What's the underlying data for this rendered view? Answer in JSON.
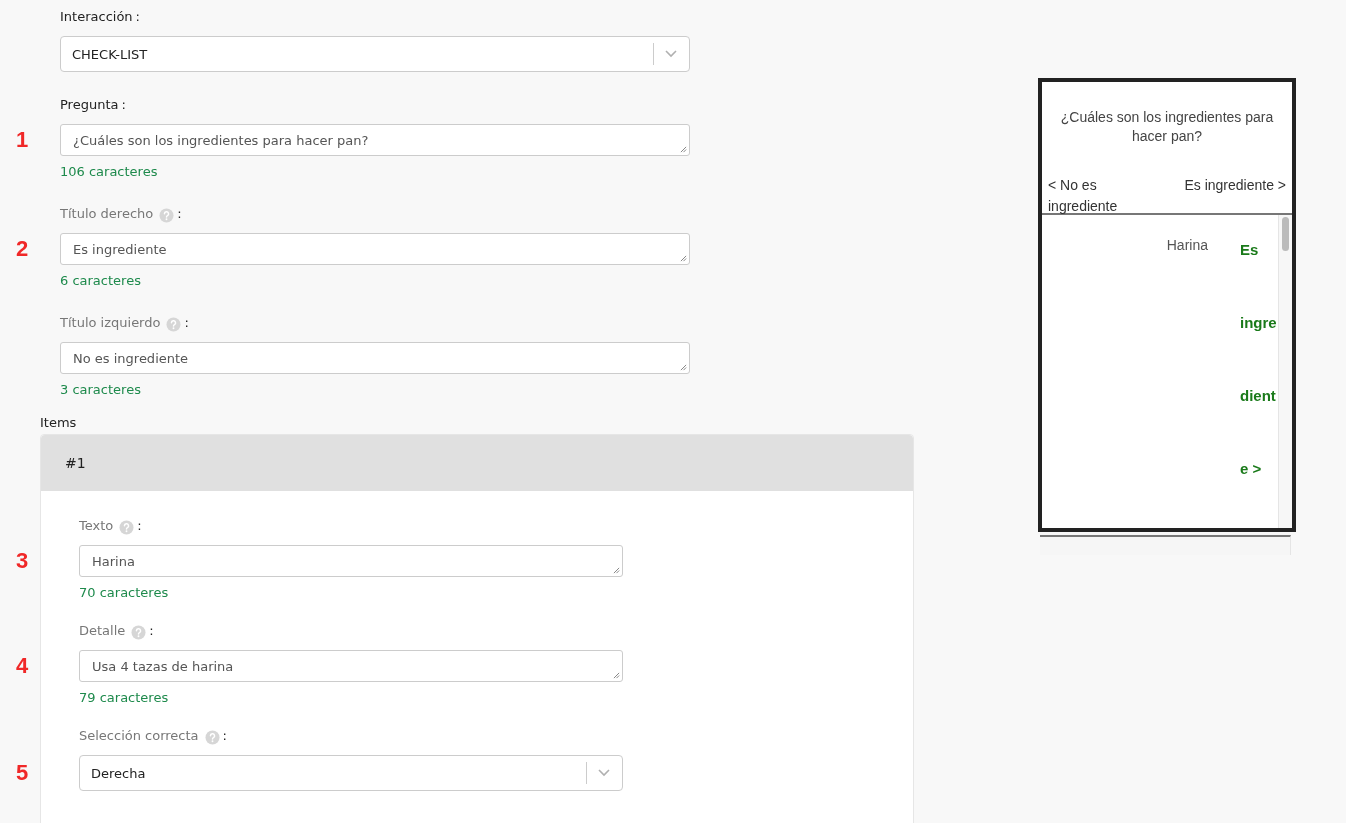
{
  "form_fields": [
    {
      "kind": "select",
      "label": "Interacción",
      "suffix": ":",
      "help": false,
      "value": "CHECK-LIST"
    },
    {
      "kind": "textarea",
      "marker": "1",
      "label": "Pregunta",
      "suffix": ":",
      "help": false,
      "value": "¿Cuáles son los ingredientes para hacer pan?",
      "count": "106 caracteres"
    },
    {
      "kind": "textarea",
      "marker": "2",
      "label": "Título derecho",
      "suffix": ":",
      "help": true,
      "value": "Es ingrediente",
      "count": "6 caracteres"
    },
    {
      "kind": "textarea",
      "label": "Título izquierdo",
      "suffix": ":",
      "help": true,
      "value": "No es ingrediente",
      "count": "3 caracteres"
    }
  ],
  "items": {
    "label": "Items",
    "cards": [
      {
        "title": "#1",
        "fields": [
          {
            "kind": "textarea",
            "marker": "3",
            "label": "Texto",
            "suffix": ":",
            "help": true,
            "value": "Harina",
            "count": "70 caracteres"
          },
          {
            "kind": "textarea",
            "marker": "4",
            "label": "Detalle",
            "suffix": ":",
            "help": true,
            "value": "Usa 4 tazas de harina",
            "count": "79 caracteres"
          },
          {
            "kind": "select",
            "marker": "5",
            "label": "Selección correcta",
            "suffix": ":",
            "help": true,
            "value": "Derecha"
          }
        ]
      }
    ]
  },
  "preview": {
    "question": "¿Cuáles son los ingredientes para hacer pan?",
    "left_title": "< No es ingrediente",
    "right_title": "Es ingrediente >",
    "item_text": "Harina",
    "answer_fragments": [
      "Es",
      "ingre",
      "dient",
      "e >"
    ]
  }
}
